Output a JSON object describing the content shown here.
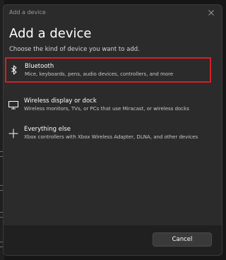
{
  "window": {
    "title": "Add a device",
    "close_icon": "close-icon"
  },
  "dialog": {
    "heading": "Add a device",
    "subtitle": "Choose the kind of device you want to add."
  },
  "options": [
    {
      "id": "bluetooth",
      "icon": "bluetooth-icon",
      "label": "Bluetooth",
      "description": "Mice, keyboards, pens, audio devices, controllers, and more",
      "highlighted": true
    },
    {
      "id": "wireless-display",
      "icon": "monitor-icon",
      "label": "Wireless display or dock",
      "description": "Wireless monitors, TVs, or PCs that use Miracast, or wireless docks",
      "highlighted": false
    },
    {
      "id": "everything-else",
      "icon": "plus-icon",
      "label": "Everything else",
      "description": "Xbox controllers with Xbox Wireless Adapter, DLNA, and other devices",
      "highlighted": false
    }
  ],
  "footer": {
    "cancel_label": "Cancel"
  },
  "colors": {
    "dialog_bg": "#2b2b2b",
    "footer_bg": "#202020",
    "highlight_border": "#d61f26",
    "text_primary": "#ffffff",
    "text_secondary": "#c8c8c8"
  }
}
